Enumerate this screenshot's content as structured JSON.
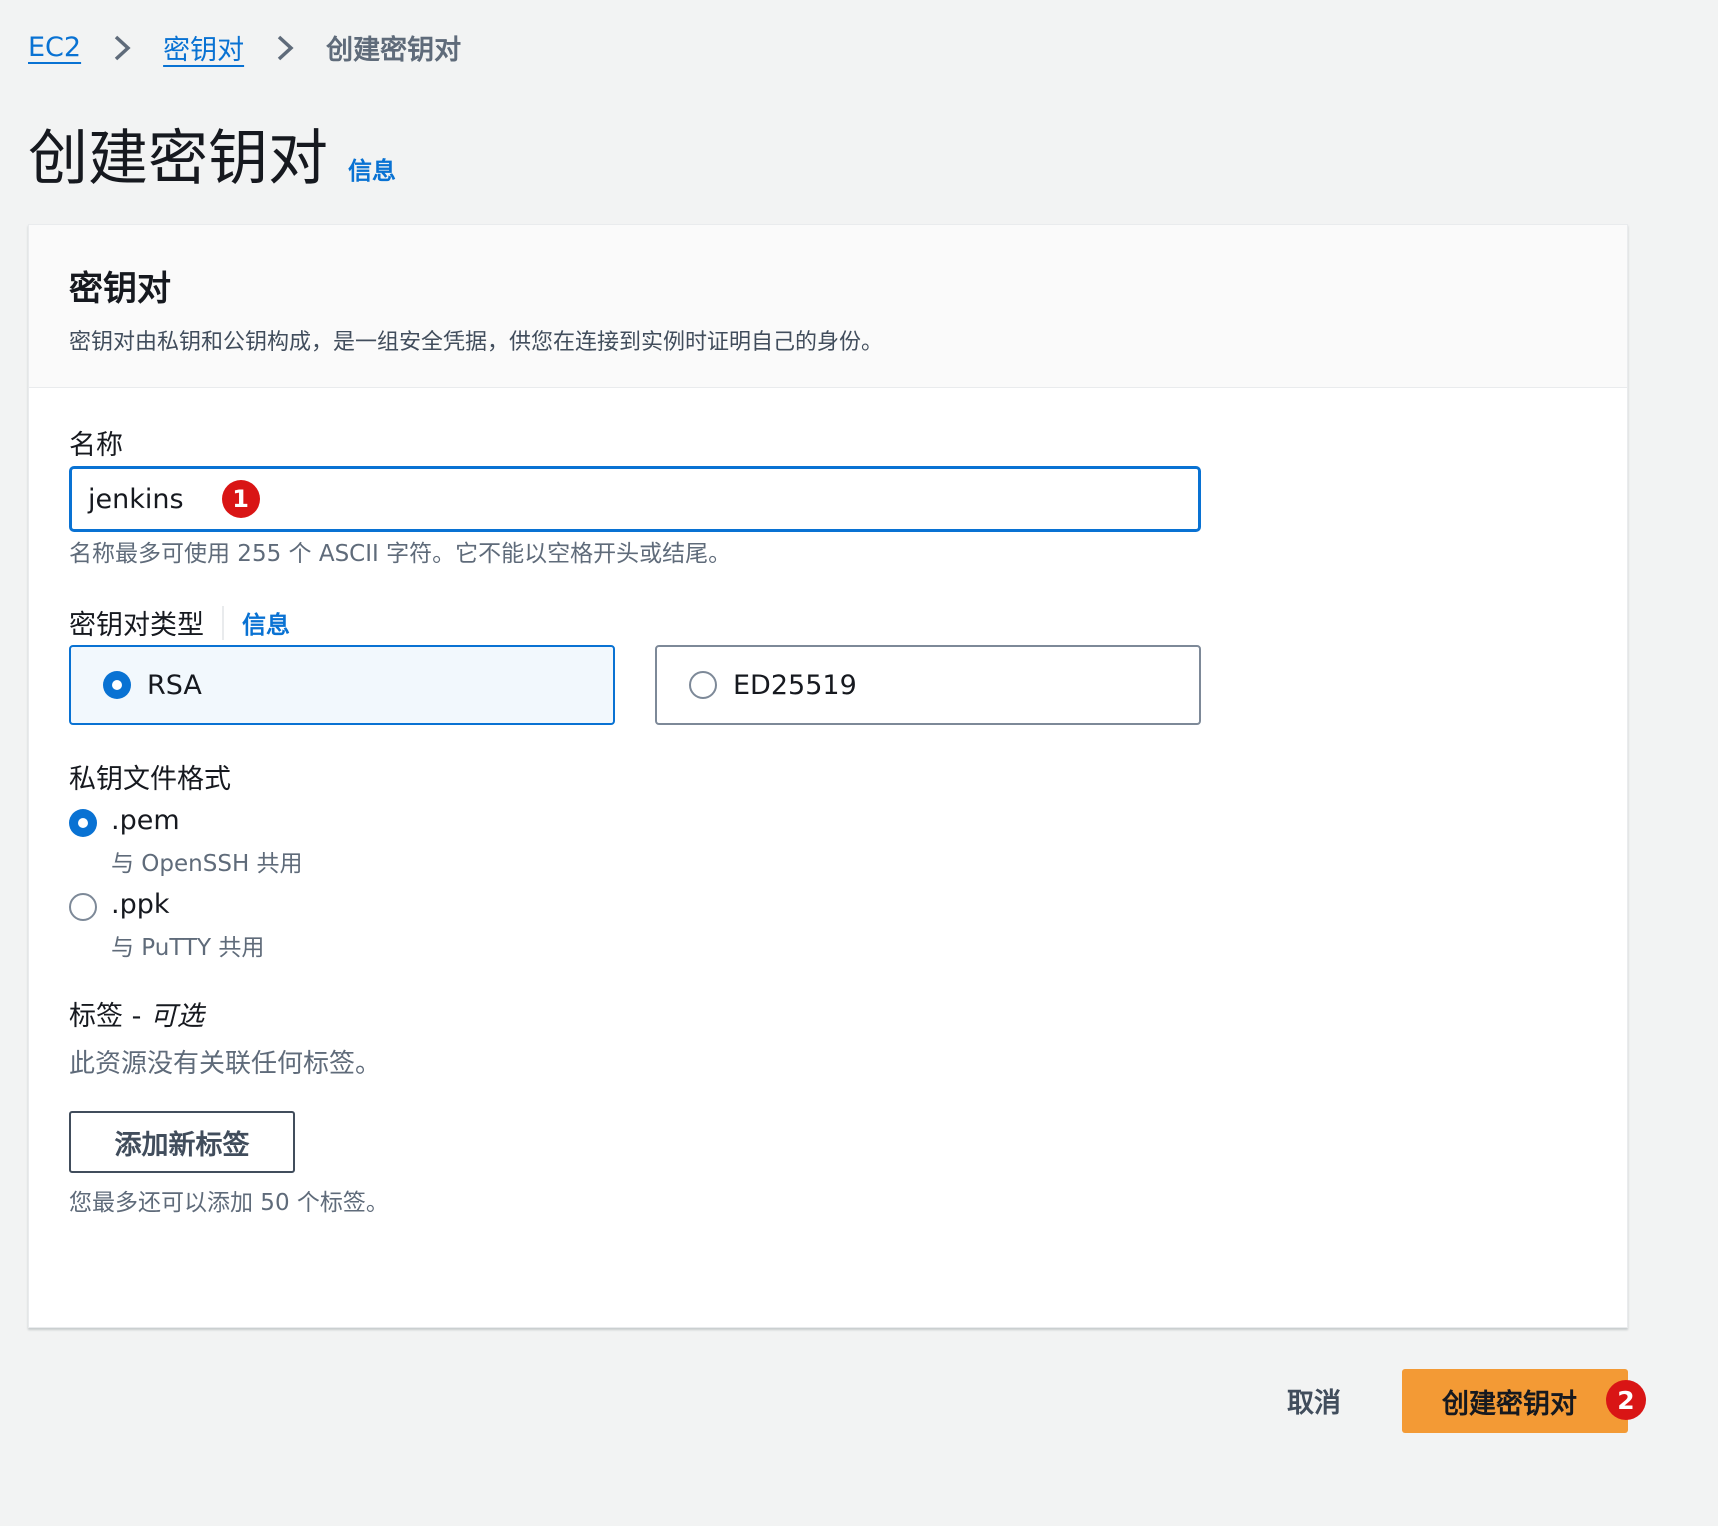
{
  "breadcrumb": {
    "items": [
      "EC2",
      "密钥对"
    ],
    "current": "创建密钥对"
  },
  "page": {
    "title": "创建密钥对",
    "info_link": "信息"
  },
  "panel": {
    "title": "密钥对",
    "description": "密钥对由私钥和公钥构成，是一组安全凭据，供您在连接到实例时证明自己的身份。"
  },
  "name_field": {
    "label": "名称",
    "value": "jenkins",
    "hint": "名称最多可使用 255 个 ASCII 字符。它不能以空格开头或结尾。",
    "badge": "1"
  },
  "key_type": {
    "label": "密钥对类型",
    "info_link": "信息",
    "options": [
      {
        "label": "RSA",
        "selected": true
      },
      {
        "label": "ED25519",
        "selected": false
      }
    ]
  },
  "file_format": {
    "label": "私钥文件格式",
    "options": [
      {
        "label": ".pem",
        "description": "与 OpenSSH 共用",
        "selected": true
      },
      {
        "label": ".ppk",
        "description": "与 PuTTY 共用",
        "selected": false
      }
    ]
  },
  "tags": {
    "label": "标签 - ",
    "label_optional": "可选",
    "empty_text": "此资源没有关联任何标签。",
    "add_button": "添加新标签",
    "limit_text": "您最多还可以添加 50 个标签。"
  },
  "footer": {
    "cancel": "取消",
    "submit": "创建密钥对",
    "submit_badge": "2"
  },
  "colors": {
    "link": "#0972d3",
    "primary_button": "#f39a35",
    "badge": "#d91515",
    "background": "#f2f3f3"
  }
}
